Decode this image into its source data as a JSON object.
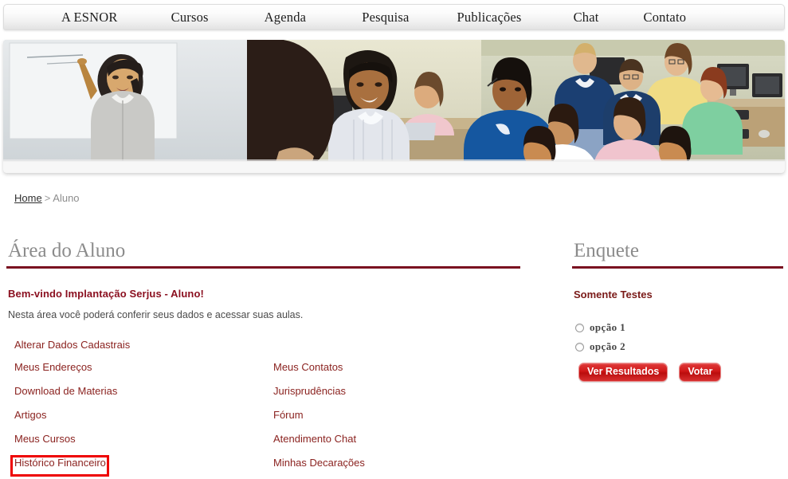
{
  "nav": {
    "items": [
      {
        "label": "A ESNOR",
        "name": "nav-item-a-esnor"
      },
      {
        "label": "Cursos",
        "name": "nav-item-cursos"
      },
      {
        "label": "Agenda",
        "name": "nav-item-agenda"
      },
      {
        "label": "Pesquisa",
        "name": "nav-item-pesquisa"
      },
      {
        "label": "Publicações",
        "name": "nav-item-publicacoes"
      },
      {
        "label": "Chat",
        "name": "nav-item-chat"
      },
      {
        "label": "Contato",
        "name": "nav-item-contato"
      }
    ]
  },
  "banner": {
    "alt": "classroom-photo-banner"
  },
  "breadcrumb": {
    "home": "Home",
    "separator": ">",
    "current": "Aluno"
  },
  "main": {
    "title": "Área do Aluno",
    "welcome": "Bem-vindo Implantação Serjus - Aluno!",
    "intro": "Nesta área você poderá conferir seus dados e acessar suas aulas.",
    "links_col_a": [
      "Alterar Dados Cadastrais",
      "Meus Endereços",
      "Download de Materias",
      "Artigos",
      "Meus Cursos",
      "Histórico Financeiro"
    ],
    "links_col_b": [
      "Meus Contatos",
      "Jurisprudências",
      "Fórum",
      "Atendimento Chat",
      "Minhas Decarações"
    ],
    "highlighted_link": "Meus Endereços"
  },
  "poll": {
    "title": "Enquete",
    "question": "Somente Testes",
    "options": [
      "opção  1",
      "opção  2"
    ],
    "results_button": "Ver Resultados",
    "vote_button": "Votar"
  },
  "colors": {
    "accent_red": "#7a1020",
    "link_red": "#8b2320",
    "button_red": "#cf1717",
    "highlight_red": "#ee0000",
    "heading_gray": "#8b8b8b"
  }
}
